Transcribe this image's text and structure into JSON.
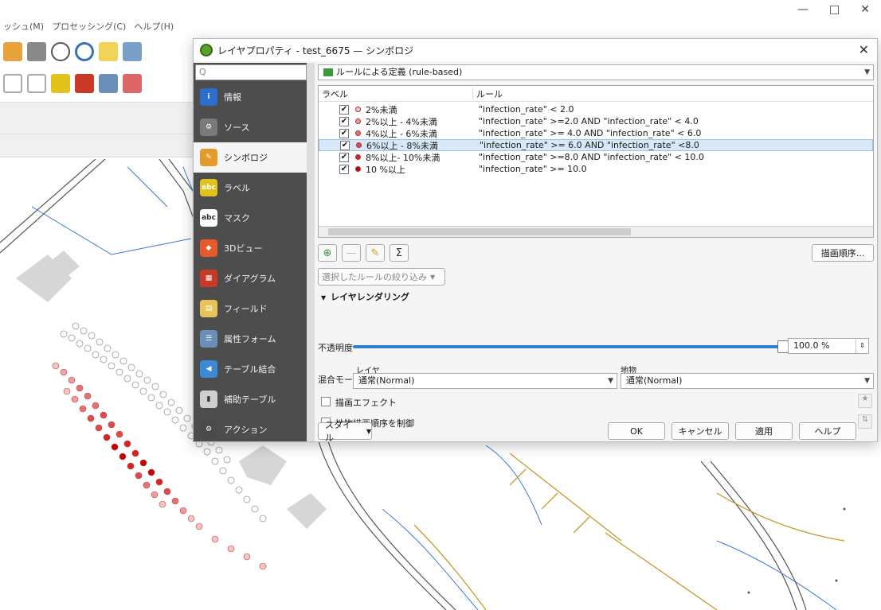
{
  "main_window": {
    "menu": [
      "ッシュ(M)",
      "プロセッシング(C)",
      "ヘルプ(H)"
    ],
    "window_controls": [
      "—",
      "□",
      "✕"
    ]
  },
  "dialog": {
    "title": "レイヤプロパティ - test_6675 — シンボロジ",
    "search_placeholder": "Q",
    "sidebar": [
      {
        "label": "情報",
        "icon": "info-icon",
        "color": "#2a6fd0",
        "glyph": "i"
      },
      {
        "label": "ソース",
        "icon": "source-icon",
        "color": "#7a7a7a",
        "glyph": "⚙"
      },
      {
        "label": "シンボロジ",
        "icon": "symbology-icon",
        "color": "#e39b2b",
        "glyph": "✎"
      },
      {
        "label": "ラベル",
        "icon": "labels-icon",
        "color": "#e2c21b",
        "glyph": "abc"
      },
      {
        "label": "マスク",
        "icon": "mask-icon",
        "color": "#ffffff",
        "glyph": "abc"
      },
      {
        "label": "3Dビュー",
        "icon": "3d-view-icon",
        "color": "#e8592a",
        "glyph": "◆"
      },
      {
        "label": "ダイアグラム",
        "icon": "diagram-icon",
        "color": "#c83a26",
        "glyph": "▦"
      },
      {
        "label": "フィールド",
        "icon": "fields-icon",
        "color": "#e6c45a",
        "glyph": "▤"
      },
      {
        "label": "属性フォーム",
        "icon": "attribute-form-icon",
        "color": "#6b8fb8",
        "glyph": "☰"
      },
      {
        "label": "テーブル結合",
        "icon": "joins-icon",
        "color": "#3a8ad8",
        "glyph": "◀"
      },
      {
        "label": "補助テーブル",
        "icon": "auxiliary-storage-icon",
        "color": "#cfcfcf",
        "glyph": "▮"
      },
      {
        "label": "アクション",
        "icon": "actions-icon",
        "color": "#4a4a4a",
        "glyph": "⚙"
      }
    ],
    "active_index": 2,
    "renderer": "ルールによる定義 (rule-based)",
    "columns": {
      "label": "ラベル",
      "rule": "ルール"
    },
    "rules": [
      {
        "label": "2%未満",
        "rule": "\"infection_rate\" < 2.0",
        "color": "#f4c6c6",
        "checked": "✔"
      },
      {
        "label": "2%以上 - 4%未満",
        "rule": "\"infection_rate\" >=2.0 AND \"infection_rate\" < 4.0",
        "color": "#ec9c9c",
        "checked": "✔"
      },
      {
        "label": "4%以上 - 6%未満",
        "rule": "\"infection_rate\" >= 4.0 AND \"infection_rate\" < 6.0",
        "color": "#e47474",
        "checked": "✔"
      },
      {
        "label": "6%以上 - 8%未満",
        "rule": "\"infection_rate\" >= 6.0 AND \"infection_rate\" <8.0",
        "color": "#dc4a4a",
        "checked": "✔"
      },
      {
        "label": "8%以上- 10%未満",
        "rule": "\"infection_rate\" >=8.0 AND \"infection_rate\" < 10.0",
        "color": "#d42424",
        "checked": "✔"
      },
      {
        "label": "10 %以上",
        "rule": "\"infection_rate\" >= 10.0",
        "color": "#c40000",
        "checked": "✔"
      }
    ],
    "selected_rule_index": 3,
    "rendering_order_button": "描画順序...",
    "refine_button": "選択したルールの絞り込み",
    "layer_rendering": {
      "heading": "レイヤレンダリング",
      "opacity_label": "不透明度",
      "opacity_value": "100.0 %",
      "opacity_fraction": 1.0,
      "blend_label": "混合モード",
      "layer_label": "レイヤ",
      "feature_label": "地物",
      "layer_blend": "通常(Normal)",
      "feature_blend": "通常(Normal)",
      "draw_effects": "描画エフェクト",
      "feature_order": "地物描画順序を制御"
    },
    "buttons": {
      "style": "スタイル",
      "ok": "OK",
      "cancel": "キャンセル",
      "apply": "適用",
      "help": "ヘルプ"
    }
  }
}
